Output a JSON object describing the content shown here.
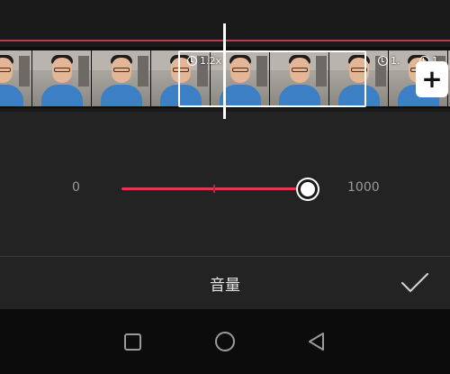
{
  "timeline": {
    "clip_speed_badges": [
      "1.2x",
      "1.",
      "1."
    ],
    "add_clip_symbol": "+"
  },
  "volume_slider": {
    "min_label": "0",
    "max_label": "1000",
    "value_fraction": 1.0
  },
  "panel": {
    "title": "音量",
    "confirm_icon": "checkmark-icon"
  },
  "nav_bar": {
    "icons": [
      "recent-apps-icon",
      "home-icon",
      "back-icon"
    ]
  },
  "colors": {
    "accent": "#e23752",
    "background": "#232323",
    "nav_background": "#0c0c0c"
  }
}
